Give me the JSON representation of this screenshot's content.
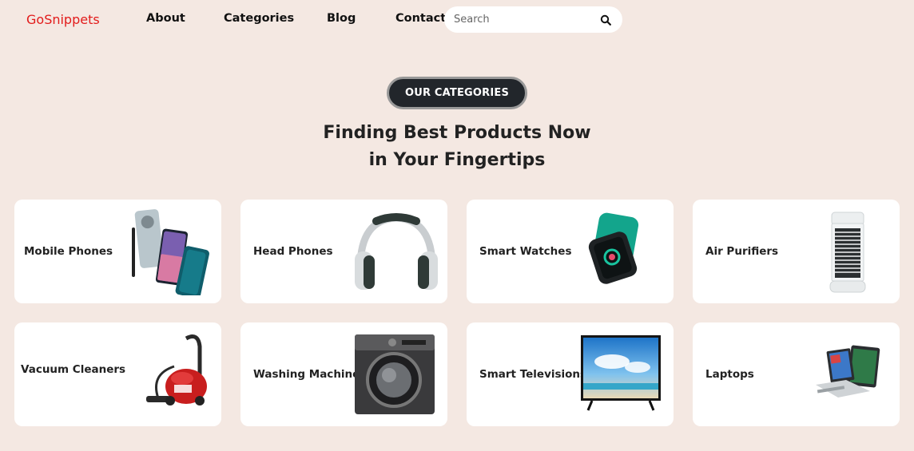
{
  "brand": {
    "logo": "GoSnippets"
  },
  "nav": {
    "items": [
      {
        "label": "About"
      },
      {
        "label": "Categories"
      },
      {
        "label": "Blog"
      },
      {
        "label": "Contact"
      }
    ]
  },
  "search": {
    "placeholder": "Search",
    "icon": "search-icon"
  },
  "hero": {
    "pill": "OUR CATEGORIES",
    "line1": "Finding Best Products Now",
    "line2": "in Your Fingertips"
  },
  "categories": [
    {
      "label": "Mobile Phones",
      "icon": "mobile-phones-image"
    },
    {
      "label": "Head Phones",
      "icon": "headphones-image"
    },
    {
      "label": "Smart Watches",
      "icon": "smartwatch-image"
    },
    {
      "label": "Air Purifiers",
      "icon": "air-purifier-image"
    },
    {
      "label": "Vacuum Cleaners",
      "icon": "vacuum-cleaner-image"
    },
    {
      "label": "Washing Machines",
      "icon": "washing-machine-image"
    },
    {
      "label": "Smart Televisions",
      "icon": "smart-tv-image"
    },
    {
      "label": "Laptops",
      "icon": "laptop-image"
    }
  ],
  "colors": {
    "background": "#f4e8e2",
    "brand": "#e21b1b",
    "pill": "#22262b"
  }
}
